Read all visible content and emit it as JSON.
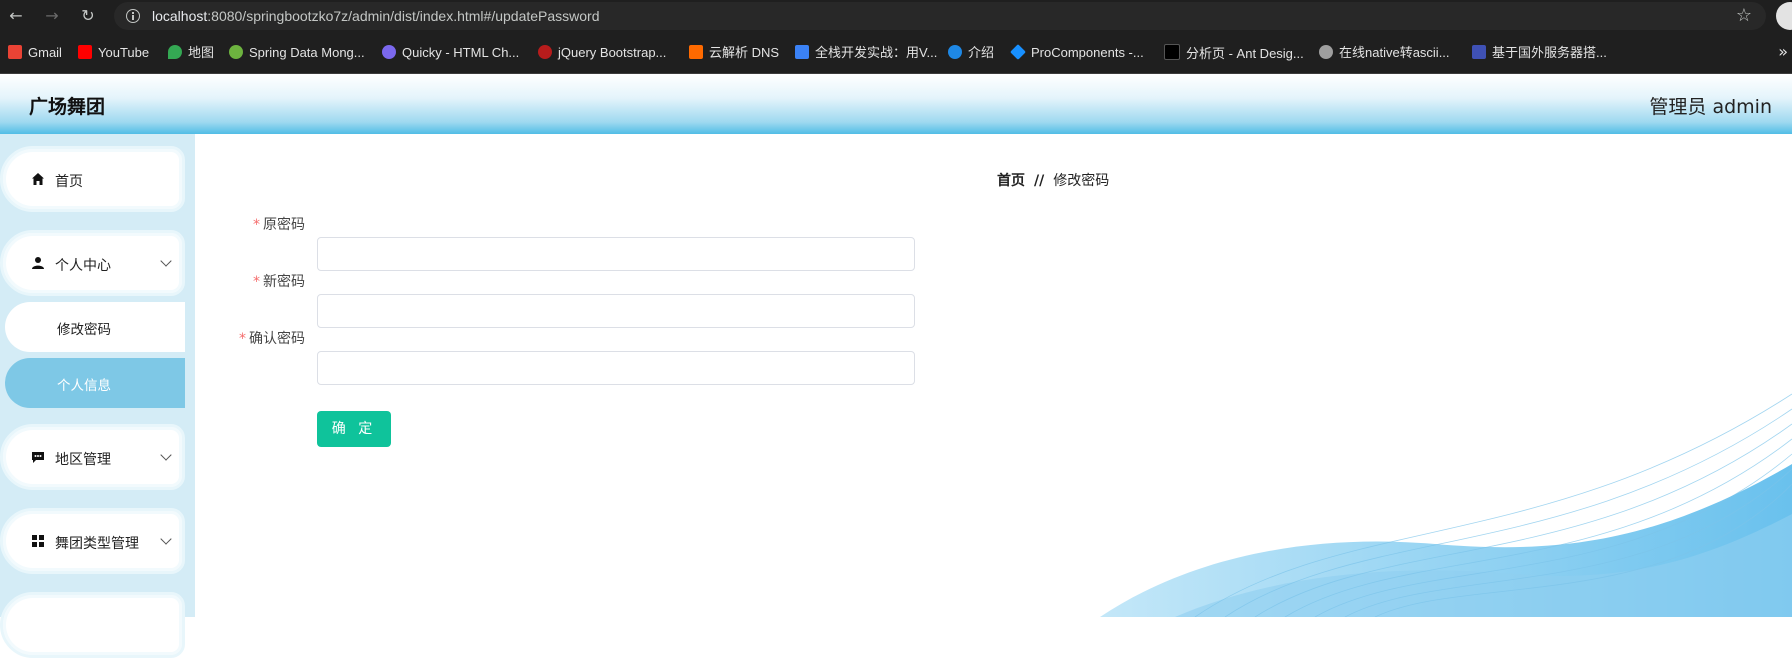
{
  "browser": {
    "url_host": "localhost",
    "url_rest": ":8080/springbootzko7z/admin/dist/index.html#/updatePassword",
    "bookmarks": [
      {
        "label": "Gmail",
        "color": "#ea4335"
      },
      {
        "label": "YouTube",
        "color": "#ff0000"
      },
      {
        "label": "地图",
        "color": "#34a853"
      },
      {
        "label": "Spring Data Mong...",
        "color": "#6db33f"
      },
      {
        "label": "Quicky - HTML Ch...",
        "color": "#7b68ee"
      },
      {
        "label": "jQuery Bootstrap...",
        "color": "#b71c1c"
      },
      {
        "label": "云解析 DNS",
        "color": "#ff6a00"
      },
      {
        "label": "全栈开发实战：用V...",
        "color": "#3b82f6"
      },
      {
        "label": "介绍",
        "color": "#1e88e5"
      },
      {
        "label": "ProComponents -...",
        "color": "#1890ff"
      },
      {
        "label": "分析页 - Ant Desig...",
        "color": "#000000"
      },
      {
        "label": "在线native转ascii...",
        "color": "#9e9e9e"
      },
      {
        "label": "基于国外服务器搭...",
        "color": "#3f51b5"
      }
    ]
  },
  "header": {
    "title": "广场舞团",
    "user": "管理员 admin"
  },
  "sidebar": {
    "items": [
      {
        "label": "首页",
        "icon": "home-icon"
      },
      {
        "label": "个人中心",
        "icon": "user-icon",
        "expanded": true,
        "children": [
          {
            "label": "修改密码",
            "active": false
          },
          {
            "label": "个人信息",
            "active": true
          }
        ]
      },
      {
        "label": "地区管理",
        "icon": "chat-icon"
      },
      {
        "label": "舞团类型管理",
        "icon": "grid-icon"
      }
    ]
  },
  "breadcrumb": {
    "home": "首页",
    "separator": "//",
    "current": "修改密码"
  },
  "form": {
    "required_mark": "*",
    "fields": [
      {
        "label": "原密码",
        "value": ""
      },
      {
        "label": "新密码",
        "value": ""
      },
      {
        "label": "确认密码",
        "value": ""
      }
    ],
    "submit_label": "确 定"
  },
  "colors": {
    "accent": "#0fc39b",
    "sidebar_active": "#7ec8e6",
    "header_blue": "#51bde6"
  }
}
